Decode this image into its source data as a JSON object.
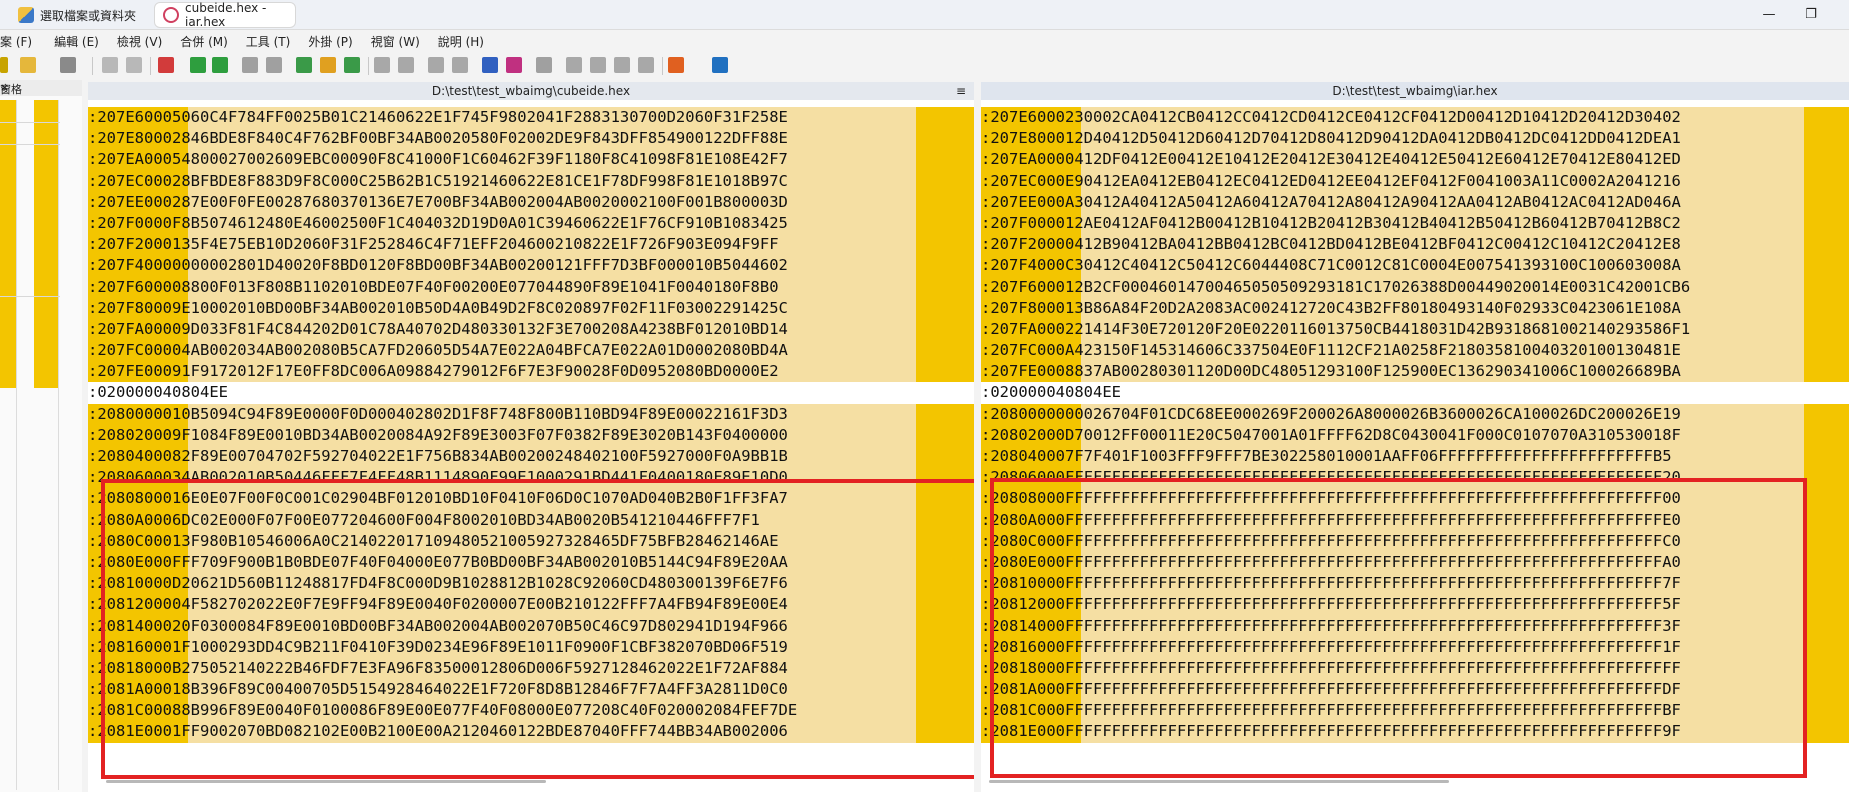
{
  "tabs": [
    {
      "label": "選取檔案或資料夾"
    },
    {
      "label": "cubeide.hex - iar.hex"
    }
  ],
  "window": {
    "minimize": "—",
    "maximize": "❐"
  },
  "menu": [
    "案 (F)",
    "編輯 (E)",
    "檢視 (V)",
    "合併 (M)",
    "工具 (T)",
    "外掛 (P)",
    "視窗 (W)",
    "說明 (H)"
  ],
  "leftpane": {
    "title": "窗格",
    "close": "×"
  },
  "left": {
    "path": "D:\\test\\test_wbaimg\\cubeide.hex",
    "menu_glyph": "≡",
    "rows": [
      ":207E60005060C4F784FF0025B01C21460622E1F745F9802041F2883130700D2060F31F258E",
      ":207E80002846BDE8F840C4F762BF00BF34AB0020580F02002DE9F843DFF854900122DFF88E",
      ":207EA00054800027002609EBC00090F8C41000F1C60462F39F1180F8C41098F81E108E42F7",
      ":207EC00028BFBDE8F883D9F8C000C25B62B1C51921460622E81CE1F78DF998F81E1018B97C",
      ":207EE000287E00F0FE00287680370136E7E700BF34AB002004AB0020002100F001B800003D",
      ":207F0000F8B5074612480E46002500F1C404032D19D0A01C39460622E1F76CF910B1083425",
      ":207F2000135F4E75EB10D2060F31F252846C4F71EFF204600210822E1F726F903E094F9FF",
      ":207F40000000002801D40020F8BD0120F8BD00BF34AB00200121FFF7D3BF000010B5044602",
      ":207F600008800F013F808B1102010BDE07F40F00200E077044890F89E1041F0040180F8B0",
      ":207F80009E10002010BD00BF34AB002010B50D4A0B49D2F8C020897F02F11F03002291425C",
      ":207FA00009D033F81F4C844202D01C78A40702D480330132F3E700208A4238BF012010BD14",
      ":207FC00004AB002034AB002080B5CA7FD20605D54A7E022A04BFCA7E022A01D0002080BD4A",
      ":207FE00091F9172012F17E0FF8DC006A09884279012F6F7E3F90028F0D0952080BD0000E2",
      ":020000040804EE",
      ":2080000010B5094C94F89E0000F0D000402802D1F8F748F800B110BD94F89E00022161F3D3",
      ":208020009F1084F89E0010BD34AB0020084A92F89E3003F07F0382F89E3020B143F0400000",
      ":2080400082F89E00704702F592704022E1F756B834AB00200248402100F5927000F0A9BB1B",
      ":2080600034AB002010B50446FFF7F4FF48B1114890F99E1000291BD441F0400180F89E10D0",
      ":2080800016E0E07F00F0C001C02904BF012010BD10F0410F06D0C1070AD040B2B0F1FF3FA7",
      ":2080A0006DC02E000F07F00E077204600F004F8002010BD34AB0020B541210446FFF7F1",
      ":2080C00013F980B10546006A0C214022017109480521005927328465DF75BFB28462146AE",
      ":2080E000FFF709F900B1B0BDE07F40F04000E077B0BD00BF34AB002010B5144C94F89E20AA",
      ":20810000D20621D560B11248817FD4F8C000D9B1028812B1028C92060CD480300139F6E7F6",
      ":2081200004F582702022E0F7E9FF94F89E0040F0200007E00B210122FFF7A4FB94F89E00E4",
      ":2081400020F0300084F89E0010BD00BF34AB002004AB002070B50C46C97D802941D194F966",
      ":208160001F1000293DD4C9B211F0410F39D0234E96F89E1011F0900F1CBF382070BD06F519",
      ":20818000B275052140222B46FDF7E3FA96F83500012806D006F5927128462022E1F72AF884",
      ":2081A00018B396F89C00400705D5154928464022E1F720F8D8B12846F7F7A4FF3A2811D0C0",
      ":2081C00088B996F89E0040F0100086F89E00E077F40F08000E077208C40F020002084FEF7DE",
      ":2081E0001FF9002070BD082102E00B2100E00A2120460122BDE87040FFF744BB34AB002006"
    ]
  },
  "right": {
    "path": "D:\\test\\test_wbaimg\\iar.hex",
    "rows": [
      ":207E6000230002CA0412CB0412CC0412CD0412CE0412CF0412D00412D10412D20412D30402",
      ":207E800012D40412D50412D60412D70412D80412D90412DA0412DB0412DC0412DD0412DEA1",
      ":207EA0000412DF0412E00412E10412E20412E30412E40412E50412E60412E70412E80412ED",
      ":207EC000E90412EA0412EB0412EC0412ED0412EE0412EF0412F0041003A11C0002A2041216",
      ":207EE000A30412A40412A50412A60412A70412A80412A90412AA0412AB0412AC0412AD046A",
      ":207F000012AE0412AF0412B00412B10412B20412B30412B40412B50412B60412B70412B8C2",
      ":207F20000412B90412BA0412BB0412BC0412BD0412BE0412BF0412C00412C10412C20412E8",
      ":207F4000C30412C40412C50412C6044408C71C0012C81C0004E007541393100C100603008A",
      ":207F600012B2CF00046014700465050509293181C17026388D00449020014E0031C42001CB6",
      ":207F800013B86A84F20D2A2083AC002412720C43B2FF80180493140F02933C0423061E108A",
      ":207FA000221414F30E720120F20E0220116013750CB4418031D42B9318681002140293586F1",
      ":207FC000A423150F145314606C337504E0F1112CF21A0258F218035810040320100130481E",
      ":207FE0008837AB00280301120D00DC48051293100F125900EC136290341006C100026689BA",
      ":020000040804EE",
      ":2080000000026704F01CDC68EE000269F200026A8000026B3600026CA100026DC200026E19",
      ":20802000D70012FF00011E20C5047001A01FFFF62D8C0430041F000C0107070A310530018F",
      ":208040007F7F401F1003FFF9FFF7BE302258010001AAFF06FFFFFFFFFFFFFFFFFFFFFFFB5",
      ":20806000FFFFFFFFFFFFFFFFFFFFFFFFFFFFFFFFFFFFFFFFFFFFFFFFFFFFFFFFFFFFFFFF20",
      ":20808000FFFFFFFFFFFFFFFFFFFFFFFFFFFFFFFFFFFFFFFFFFFFFFFFFFFFFFFFFFFFFFFF00",
      ":2080A000FFFFFFFFFFFFFFFFFFFFFFFFFFFFFFFFFFFFFFFFFFFFFFFFFFFFFFFFFFFFFFFFE0",
      ":2080C000FFFFFFFFFFFFFFFFFFFFFFFFFFFFFFFFFFFFFFFFFFFFFFFFFFFFFFFFFFFFFFFFC0",
      ":2080E000FFFFFFFFFFFFFFFFFFFFFFFFFFFFFFFFFFFFFFFFFFFFFFFFFFFFFFFFFFFFFFFFA0",
      ":20810000FFFFFFFFFFFFFFFFFFFFFFFFFFFFFFFFFFFFFFFFFFFFFFFFFFFFFFFFFFFFFFFF7F",
      ":20812000FFFFFFFFFFFFFFFFFFFFFFFFFFFFFFFFFFFFFFFFFFFFFFFFFFFFFFFFFFFFFFFF5F",
      ":20814000FFFFFFFFFFFFFFFFFFFFFFFFFFFFFFFFFFFFFFFFFFFFFFFFFFFFFFFFFFFFFFFF3F",
      ":20816000FFFFFFFFFFFFFFFFFFFFFFFFFFFFFFFFFFFFFFFFFFFFFFFFFFFFFFFFFFFFFFFF1F",
      ":20818000FFFFFFFFFFFFFFFFFFFFFFFFFFFFFFFFFFFFFFFFFFFFFFFFFFFFFFFFFFFFFFFFFF",
      ":2081A000FFFFFFFFFFFFFFFFFFFFFFFFFFFFFFFFFFFFFFFFFFFFFFFFFFFFFFFFFFFFFFFFDF",
      ":2081C000FFFFFFFFFFFFFFFFFFFFFFFFFFFFFFFFFFFFFFFFFFFFFFFFFFFFFFFFFFFFFFFFBF",
      ":2081E000FFFFFFFFFFFFFFFFFFFFFFFFFFFFFFFFFFFFFFFFFFFFFFFFFFFFFFFFFFFFFFFF9F"
    ]
  },
  "colors": {
    "diff_bg": "#f5dfa3",
    "address_bg": "#f3c500",
    "highlight_box": "#e32222"
  },
  "icons": [
    "new-icon",
    "open-icon",
    "save-icon",
    "undo-icon",
    "redo-icon",
    "bookmark-icon",
    "merge-down-icon",
    "merge-up-icon",
    "copy-left-icon",
    "copy-right-icon",
    "all-down-icon",
    "all-up-icon",
    "next-diff-icon",
    "prev-diff-icon",
    "first-diff-icon",
    "last-diff-icon",
    "current-diff-icon",
    "refresh-icon",
    "options-icon"
  ]
}
